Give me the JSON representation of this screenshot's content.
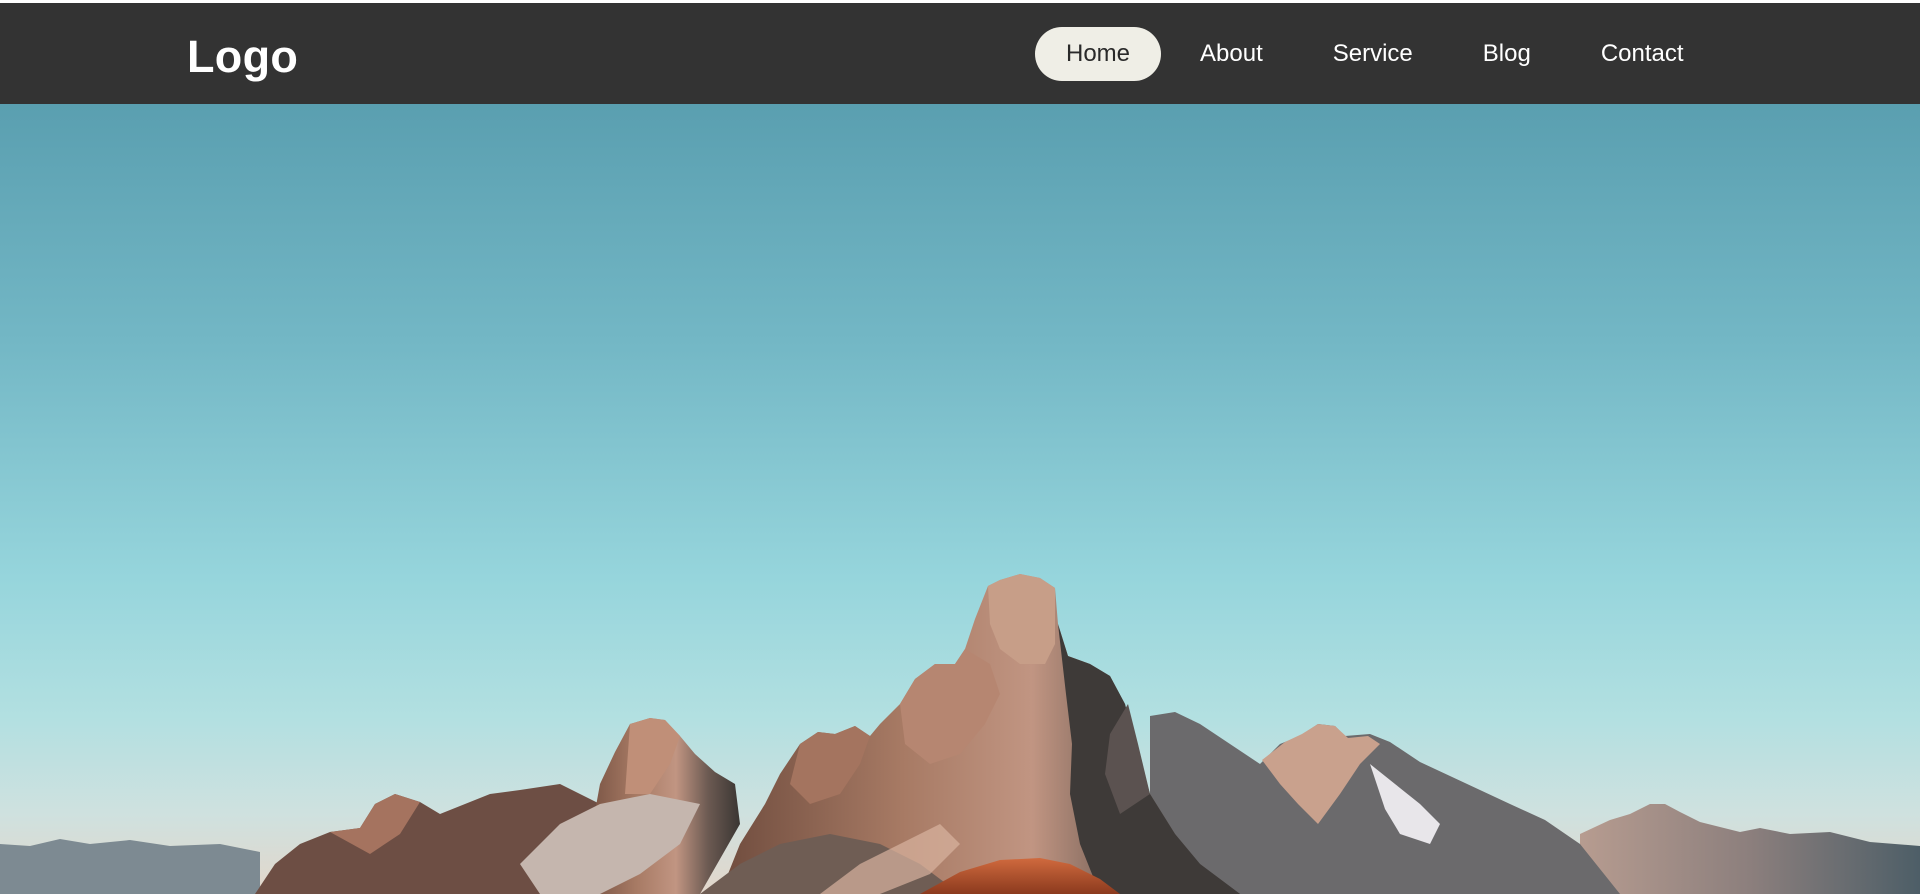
{
  "header": {
    "logo_text": "Logo",
    "nav": [
      {
        "label": "Home",
        "active": true
      },
      {
        "label": "About",
        "active": false
      },
      {
        "label": "Service",
        "active": false
      },
      {
        "label": "Blog",
        "active": false
      },
      {
        "label": "Contact",
        "active": false
      }
    ]
  },
  "hero": {
    "image_subject": "mountain peaks at sunset under a clear blue sky",
    "colors": {
      "sky_top": "#5ba0b0",
      "sky_mid": "#8fd0d8",
      "sky_horizon": "#d9d7d3",
      "rock_lit": "#b98a72",
      "rock_shadow": "#3c3a38",
      "slope_orange": "#c2502a"
    }
  },
  "theme": {
    "navbar_bg": "#333333",
    "active_pill_bg": "#efeee6",
    "nav_text": "#ffffff",
    "active_text": "#2a2a2a"
  }
}
